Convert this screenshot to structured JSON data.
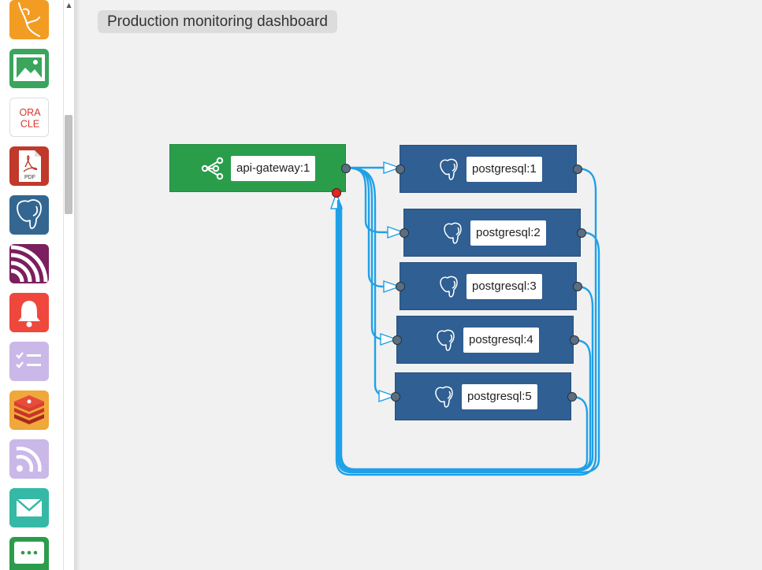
{
  "dashboard": {
    "title": "Production monitoring dashboard"
  },
  "palette": {
    "items": [
      {
        "name": "mysql",
        "color": "#f39c24"
      },
      {
        "name": "image",
        "color": "#3aa55d"
      },
      {
        "name": "oracle",
        "color": "#ffffff",
        "text": [
          "ORA",
          "CLE"
        ]
      },
      {
        "name": "pdf",
        "color": "#c0392b",
        "text": [
          "PDF"
        ]
      },
      {
        "name": "postgresql",
        "color": "#336791"
      },
      {
        "name": "rss-feed",
        "color": "#7b1f5e"
      },
      {
        "name": "alert-bell",
        "color": "#f0473d"
      },
      {
        "name": "checklist",
        "color": "#c9b8e8"
      },
      {
        "name": "redis",
        "color": "#f0a83a"
      },
      {
        "name": "rss",
        "color": "#c9b8e8"
      },
      {
        "name": "email",
        "color": "#35b9a6"
      },
      {
        "name": "chat",
        "color": "#2c9c4c"
      }
    ]
  },
  "nodes": [
    {
      "id": "api-gateway:1",
      "label": "api-gateway:1",
      "kind": "gateway",
      "icon": "share-icon"
    },
    {
      "id": "postgresql:1",
      "label": "postgresql:1",
      "kind": "db",
      "icon": "postgresql-elephant-icon"
    },
    {
      "id": "postgresql:2",
      "label": "postgresql:2",
      "kind": "db",
      "icon": "postgresql-elephant-icon"
    },
    {
      "id": "postgresql:3",
      "label": "postgresql:3",
      "kind": "db",
      "icon": "postgresql-elephant-icon"
    },
    {
      "id": "postgresql:4",
      "label": "postgresql:4",
      "kind": "db",
      "icon": "postgresql-elephant-icon"
    },
    {
      "id": "postgresql:5",
      "label": "postgresql:5",
      "kind": "db",
      "icon": "postgresql-elephant-icon"
    }
  ],
  "edges": [
    {
      "from": "api-gateway:1",
      "to": "postgresql:1"
    },
    {
      "from": "api-gateway:1",
      "to": "postgresql:2"
    },
    {
      "from": "api-gateway:1",
      "to": "postgresql:3"
    },
    {
      "from": "api-gateway:1",
      "to": "postgresql:4"
    },
    {
      "from": "api-gateway:1",
      "to": "postgresql:5"
    },
    {
      "from": "postgresql:1",
      "to": "api-gateway:1"
    },
    {
      "from": "postgresql:2",
      "to": "api-gateway:1"
    },
    {
      "from": "postgresql:3",
      "to": "api-gateway:1"
    },
    {
      "from": "postgresql:4",
      "to": "api-gateway:1"
    },
    {
      "from": "postgresql:5",
      "to": "api-gateway:1"
    }
  ],
  "colors": {
    "gateway": "#2a9d4b",
    "db": "#2f5f93",
    "edge": "#1ea1e8",
    "error_port": "#e8231d"
  }
}
